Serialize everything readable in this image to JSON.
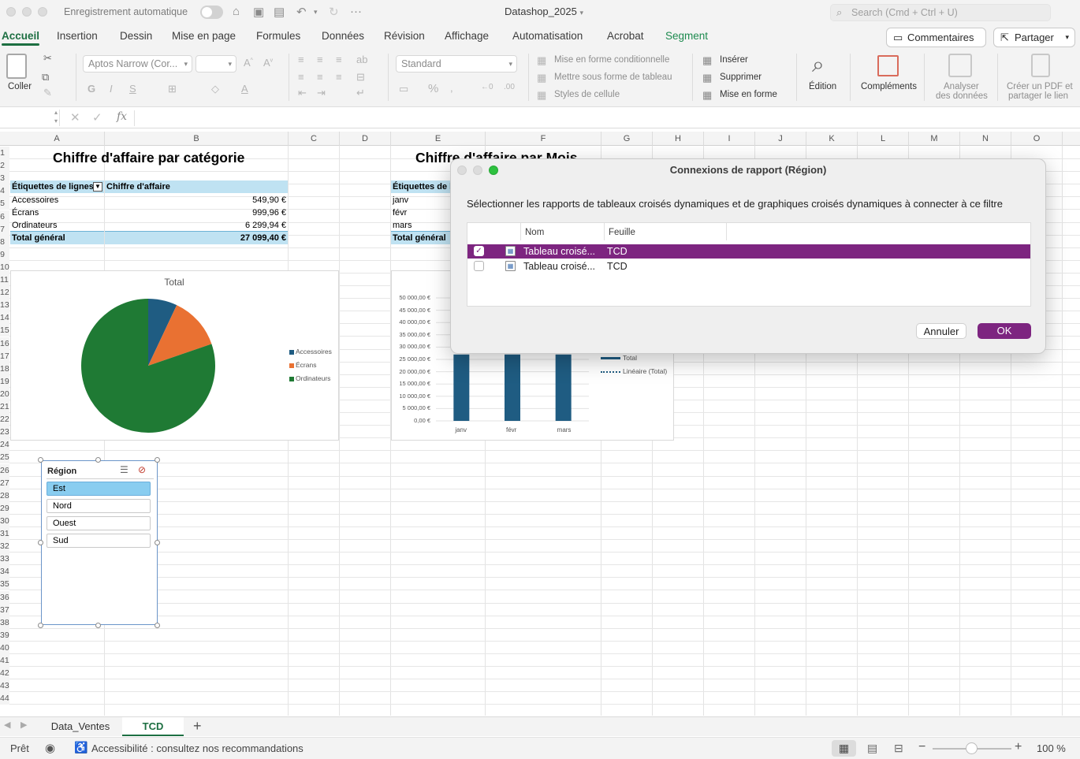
{
  "titlebar": {
    "autosave_label": "Enregistrement automatique",
    "document_title": "Datashop_2025",
    "search_placeholder": "Search (Cmd + Ctrl + U)"
  },
  "ribbon_tabs": [
    "Accueil",
    "Insertion",
    "Dessin",
    "Mise en page",
    "Formules",
    "Données",
    "Révision",
    "Affichage",
    "Automatisation",
    "Acrobat",
    "Segment"
  ],
  "actions": {
    "comments": "Commentaires",
    "share": "Partager"
  },
  "ribbon": {
    "paste": "Coller",
    "font_name": "Aptos Narrow (Cor...",
    "number_format": "Standard",
    "conditional_format": "Mise en forme conditionnelle",
    "format_as_table": "Mettre sous forme de tableau",
    "cell_styles": "Styles de cellule",
    "insert": "Insérer",
    "delete": "Supprimer",
    "format": "Mise en forme",
    "editing": "Édition",
    "addins": "Compléments",
    "analyze_1": "Analyser",
    "analyze_2": "des données",
    "pdf_1": "Créer un PDF et",
    "pdf_2": "partager le lien"
  },
  "formula": {
    "fx": "fx"
  },
  "columns": [
    "A",
    "B",
    "C",
    "D",
    "E",
    "F",
    "G",
    "H",
    "I",
    "J",
    "K",
    "L",
    "M",
    "N",
    "O"
  ],
  "rows": [
    "1",
    "2",
    "3",
    "4",
    "5",
    "6",
    "7",
    "8",
    "9",
    "10",
    "11",
    "12",
    "13",
    "14",
    "15",
    "16",
    "17",
    "18",
    "19",
    "20",
    "21",
    "22",
    "23",
    "24",
    "25",
    "26",
    "27",
    "28",
    "29",
    "30",
    "31",
    "32",
    "33",
    "34",
    "35",
    "36",
    "37",
    "38",
    "39",
    "40",
    "41",
    "42",
    "43",
    "44"
  ],
  "sheet": {
    "title_category": "Chiffre d'affaire par catégorie",
    "title_month": "Chiffre d'affaire par Mois",
    "pivot1": {
      "row_labels": "Étiquettes de lignes",
      "value_header": "Chiffre d'affaire",
      "rows": [
        {
          "label": "Accessoires",
          "value": "549,90 €"
        },
        {
          "label": "Écrans",
          "value": "999,96 €"
        },
        {
          "label": "Ordinateurs",
          "value": "6 299,94 €"
        }
      ],
      "total_label": "Total général",
      "total_value": "27 099,40 €"
    },
    "pivot2": {
      "row_labels": "Étiquettes de li",
      "rows": [
        "janv",
        "févr",
        "mars"
      ],
      "total_label": "Total général"
    }
  },
  "chart_data": [
    {
      "type": "pie",
      "title": "Total",
      "categories": [
        "Accessoires",
        "Écrans",
        "Ordinateurs"
      ],
      "values": [
        549.9,
        999.96,
        6299.94
      ],
      "colors": [
        "#1f5c82",
        "#e97132",
        "#1f7a34"
      ],
      "legend": "right"
    },
    {
      "type": "bar",
      "categories": [
        "janv",
        "févr",
        "mars"
      ],
      "series": [
        {
          "name": "Total",
          "values": [
            27000,
            27000,
            27000
          ]
        }
      ],
      "trendline": "Linéaire (Total)",
      "ylim": [
        0,
        50000
      ],
      "yticks": [
        "0,00 €",
        "5 000,00 €",
        "10 000,00 €",
        "15 000,00 €",
        "20 000,00 €",
        "25 000,00 €",
        "30 000,00 €",
        "35 000,00 €",
        "40 000,00 €",
        "45 000,00 €",
        "50 000,00 €"
      ],
      "color": "#1f5c82",
      "legend": "right"
    }
  ],
  "slicer": {
    "title": "Région",
    "items": [
      {
        "label": "Est",
        "selected": true
      },
      {
        "label": "Nord",
        "selected": false
      },
      {
        "label": "Ouest",
        "selected": false
      },
      {
        "label": "Sud",
        "selected": false
      }
    ]
  },
  "dialog": {
    "title": "Connexions de rapport (Région)",
    "instruction": "Sélectionner les rapports de tableaux croisés dynamiques et de graphiques croisés dynamiques à connecter à ce filtre",
    "col_name": "Nom",
    "col_sheet": "Feuille",
    "rows": [
      {
        "name": "Tableau croisé...",
        "sheet": "TCD",
        "checked": true
      },
      {
        "name": "Tableau croisé...",
        "sheet": "TCD",
        "checked": false
      }
    ],
    "cancel": "Annuler",
    "ok": "OK",
    "accent": "#7d2580"
  },
  "sheets": [
    "Data_Ventes",
    "TCD"
  ],
  "active_sheet": "TCD",
  "status": {
    "ready": "Prêt",
    "accessibility": "Accessibilité : consultez nos recommandations",
    "zoom": "100 %"
  }
}
